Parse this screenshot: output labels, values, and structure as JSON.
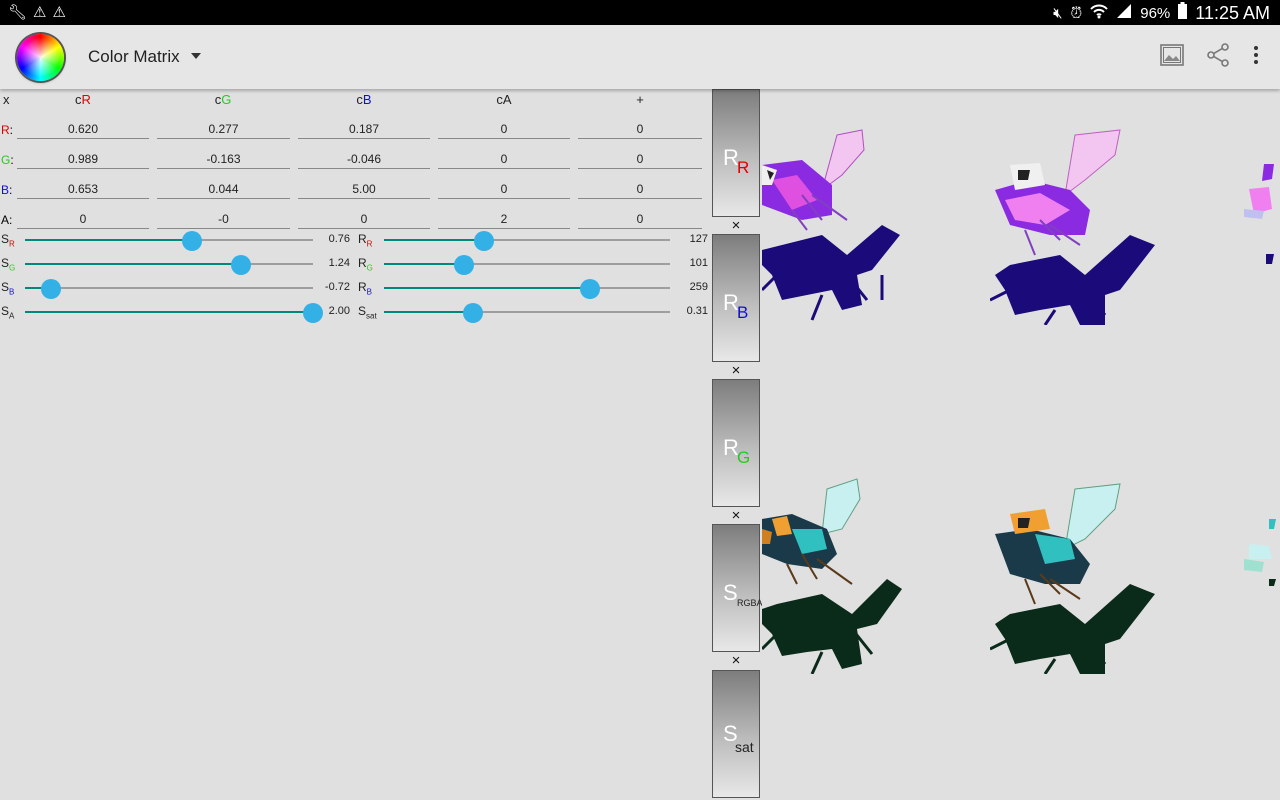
{
  "status_bar": {
    "battery": "96%",
    "time": "11:25 AM"
  },
  "app_bar": {
    "title": "Color Matrix"
  },
  "matrix": {
    "corner": "x",
    "col_headers": [
      {
        "prefix": "c",
        "channel": "R",
        "color": "#e00000"
      },
      {
        "prefix": "c",
        "channel": "G",
        "color": "#22cc22"
      },
      {
        "prefix": "c",
        "channel": "B",
        "color": "#1010d0"
      },
      {
        "prefix": "c",
        "channel": "A",
        "color": "#222222"
      },
      {
        "prefix": "",
        "channel": "+",
        "color": "#222222"
      }
    ],
    "rows": [
      {
        "label": "R",
        "color": "#e00000",
        "values": [
          "0.620",
          "0.277",
          "0.187",
          "0",
          "0"
        ]
      },
      {
        "label": "G",
        "color": "#22cc22",
        "values": [
          "0.989",
          "-0.163",
          "-0.046",
          "0",
          "0"
        ]
      },
      {
        "label": "B",
        "color": "#1010d0",
        "values": [
          "0.653",
          "0.044",
          "5.00",
          "0",
          "0"
        ]
      },
      {
        "label": "A",
        "color": "#222222",
        "values": [
          "0",
          "-0",
          "0",
          "2",
          "0"
        ]
      }
    ]
  },
  "sliders": [
    {
      "left": {
        "main": "S",
        "sub": "R",
        "sub_color": "#e00000",
        "value": "0.76",
        "fraction": 0.58
      },
      "right": {
        "main": "R",
        "sub": "R",
        "sub_color": "#e00000",
        "value": "127",
        "fraction": 0.35
      }
    },
    {
      "left": {
        "main": "S",
        "sub": "G",
        "sub_color": "#22cc22",
        "value": "1.24",
        "fraction": 0.75
      },
      "right": {
        "main": "R",
        "sub": "G",
        "sub_color": "#22cc22",
        "value": "101",
        "fraction": 0.28
      }
    },
    {
      "left": {
        "main": "S",
        "sub": "B",
        "sub_color": "#1010d0",
        "value": "-0.72",
        "fraction": 0.09
      },
      "right": {
        "main": "R",
        "sub": "B",
        "sub_color": "#1010d0",
        "value": "259",
        "fraction": 0.72
      }
    },
    {
      "left": {
        "main": "S",
        "sub": "A",
        "sub_color": "#222222",
        "value": "2.00",
        "fraction": 1.0
      },
      "right": {
        "main": "S",
        "sub": "sat",
        "sub_color": "#222222",
        "value": "0.31",
        "fraction": 0.31
      }
    }
  ],
  "side_buttons": [
    {
      "main": "R",
      "sub": "R",
      "sub_color": "#e00000"
    },
    {
      "main": "R",
      "sub": "B",
      "sub_color": "#1010d0"
    },
    {
      "main": "R",
      "sub": "G",
      "sub_color": "#22cc22"
    },
    {
      "main": "S",
      "sub": "RGBA",
      "sub_color": "#222222"
    },
    {
      "main": "S",
      "sub": "sat",
      "sub_color": "#222222"
    }
  ],
  "remove_mark": "×",
  "icons": [
    "wrench-icon",
    "warning-icon",
    "mute-icon",
    "alarm-icon",
    "wifi-icon",
    "signal-icon",
    "battery-icon",
    "color-wheel-icon",
    "image-icon",
    "share-icon",
    "overflow-menu-icon"
  ]
}
